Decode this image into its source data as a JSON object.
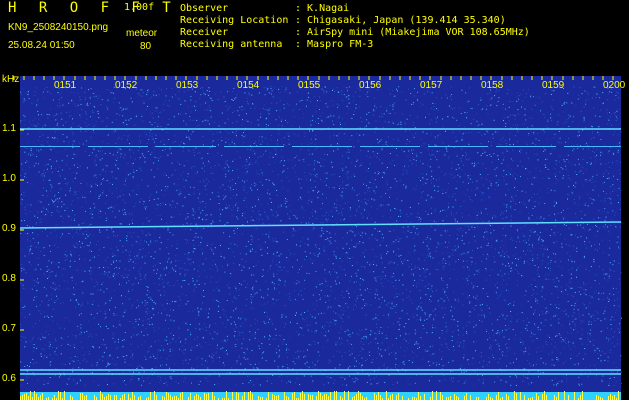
{
  "header": {
    "title": "H R O F F T",
    "version": "1.00f",
    "filename": "KN9_2508240150.png",
    "timestamp": "25.08.24 01:50",
    "meteor_label": "meteor",
    "meteor_value": "80"
  },
  "info": [
    {
      "key": "Observer",
      "value": ": K.Nagai"
    },
    {
      "key": "Receiving Location",
      "value": ": Chigasaki, Japan (139.414 35.340)"
    },
    {
      "key": "Receiver",
      "value": ": AirSpy mini (Miakejima VOR 108.65MHz)"
    },
    {
      "key": "Receiving antenna",
      "value": ": Maspro FM-3"
    }
  ],
  "chart_data": {
    "type": "heatmap",
    "ylabel": "kHz",
    "time_ticks": [
      "0151",
      "0152",
      "0153",
      "0154",
      "0155",
      "0156",
      "0157",
      "0158",
      "0159",
      "0200"
    ],
    "freq_ticks": [
      "1.1",
      "1.0",
      "0.9",
      "0.8",
      "0.7",
      "0.6"
    ],
    "ylim": [
      0.58,
      1.18
    ],
    "grid": false,
    "signal_lines_khz": [
      1.102,
      1.067,
      0.904,
      0.62,
      0.612
    ],
    "colors": {
      "background": "#1a2a9c",
      "noise": "#3fa0ff",
      "signal": "#60e0ff",
      "text": "#ffff00"
    }
  }
}
